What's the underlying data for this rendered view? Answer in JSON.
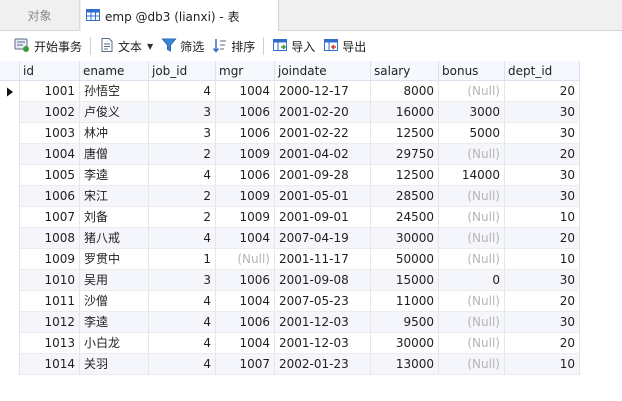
{
  "tabs": [
    {
      "label": "对象"
    },
    {
      "label": "emp @db3 (lianxi) - 表"
    }
  ],
  "toolbar": {
    "begin_transaction": "开始事务",
    "text": "文本",
    "filter": "筛选",
    "sort": "排序",
    "import": "导入",
    "export": "导出"
  },
  "table": {
    "columns": [
      "id",
      "ename",
      "job_id",
      "mgr",
      "joindate",
      "salary",
      "bonus",
      "dept_id"
    ],
    "rows": [
      [
        "1001",
        "孙悟空",
        "4",
        "1004",
        "2000-12-17",
        "8000",
        "(Null)",
        "20"
      ],
      [
        "1002",
        "卢俊义",
        "3",
        "1006",
        "2001-02-20",
        "16000",
        "3000",
        "30"
      ],
      [
        "1003",
        "林冲",
        "3",
        "1006",
        "2001-02-22",
        "12500",
        "5000",
        "30"
      ],
      [
        "1004",
        "唐僧",
        "2",
        "1009",
        "2001-04-02",
        "29750",
        "(Null)",
        "20"
      ],
      [
        "1005",
        "李逵",
        "4",
        "1006",
        "2001-09-28",
        "12500",
        "14000",
        "30"
      ],
      [
        "1006",
        "宋江",
        "2",
        "1009",
        "2001-05-01",
        "28500",
        "(Null)",
        "30"
      ],
      [
        "1007",
        "刘备",
        "2",
        "1009",
        "2001-09-01",
        "24500",
        "(Null)",
        "10"
      ],
      [
        "1008",
        "猪八戒",
        "4",
        "1004",
        "2007-04-19",
        "30000",
        "(Null)",
        "20"
      ],
      [
        "1009",
        "罗贯中",
        "1",
        "(Null)",
        "2001-11-17",
        "50000",
        "(Null)",
        "10"
      ],
      [
        "1010",
        "吴用",
        "3",
        "1006",
        "2001-09-08",
        "15000",
        "0",
        "30"
      ],
      [
        "1011",
        "沙僧",
        "4",
        "1004",
        "2007-05-23",
        "11000",
        "(Null)",
        "20"
      ],
      [
        "1012",
        "李逵",
        "4",
        "1006",
        "2001-12-03",
        "9500",
        "(Null)",
        "30"
      ],
      [
        "1013",
        "小白龙",
        "4",
        "1004",
        "2001-12-03",
        "30000",
        "(Null)",
        "20"
      ],
      [
        "1014",
        "关羽",
        "4",
        "1007",
        "2002-01-23",
        "13000",
        "(Null)",
        "10"
      ]
    ],
    "current_row": 0,
    "null_text": "(Null)"
  },
  "icons": {
    "table_icon": "table-grid-icon",
    "begin_transaction": "transaction-icon",
    "text": "document-icon",
    "filter": "funnel-icon",
    "sort": "sort-icon",
    "import": "import-icon",
    "export": "export-icon",
    "row_pointer": "row-pointer-icon"
  },
  "colors": {
    "accent": "#2f6fc9",
    "null_text": "#b5b5b5",
    "header_bg": "#f5f8fd",
    "alt_row": "#f4f6fb"
  }
}
